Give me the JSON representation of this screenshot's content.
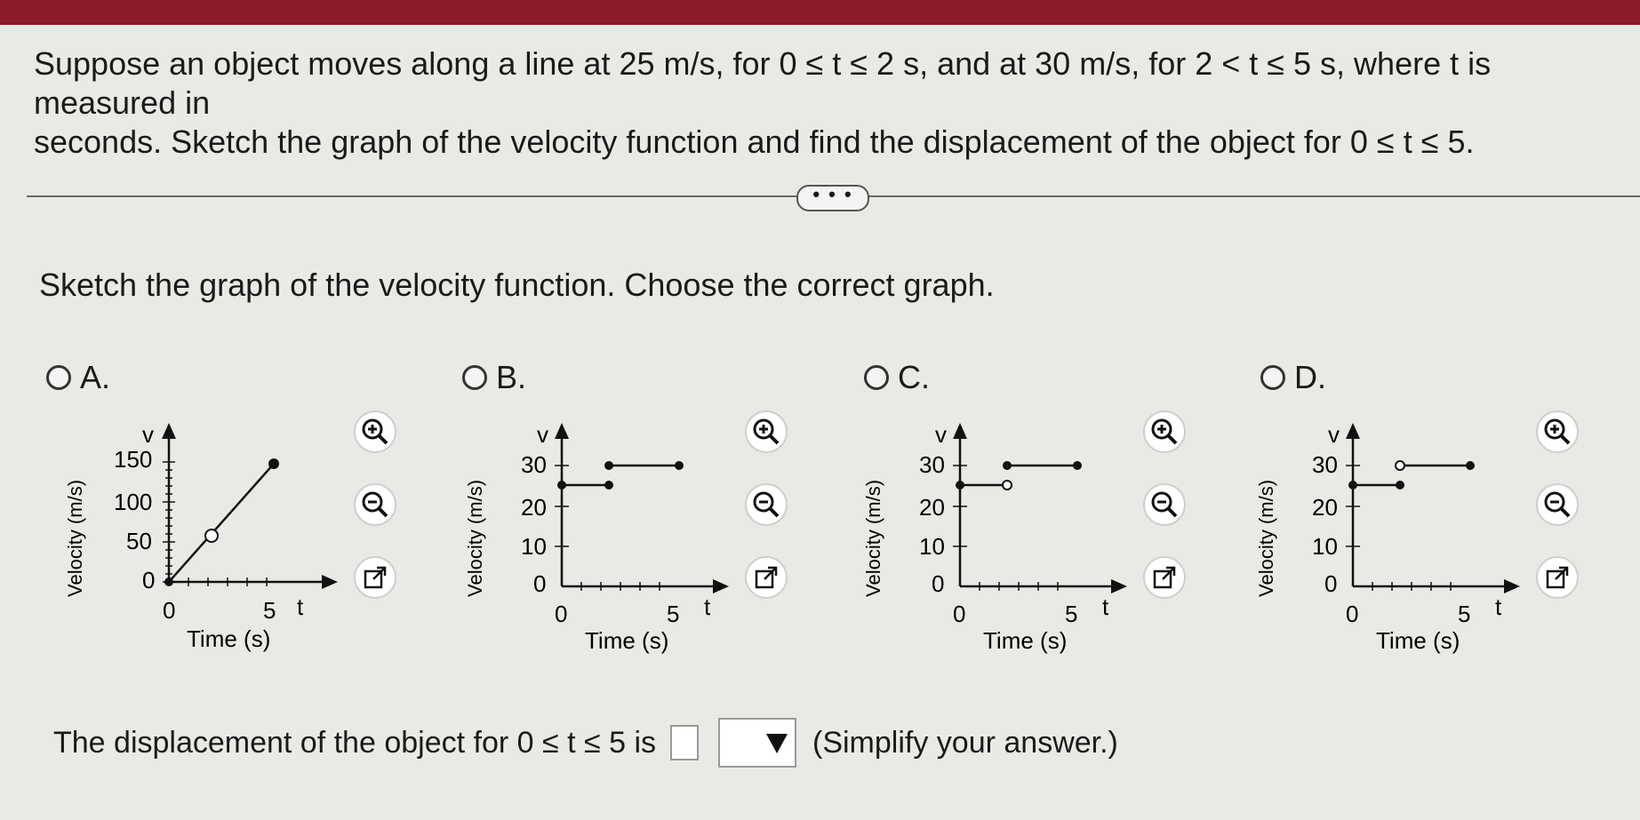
{
  "question": {
    "line1": "Suppose an object moves along a line at 25 m/s, for 0 ≤ t ≤ 2 s, and at 30 m/s, for 2 < t ≤ 5 s, where t is measured in",
    "line2": "seconds. Sketch the graph of the velocity function and find the displacement of the object for 0 ≤ t ≤ 5."
  },
  "more_button": "• • •",
  "prompt": "Sketch the graph of the velocity function. Choose the correct graph.",
  "options": [
    {
      "letter": "A.",
      "ylabel": "Velocity (m/s)",
      "xlabel": "Time (s)",
      "vlabel": "v",
      "tlabel": "t",
      "yticks": [
        "150",
        "100",
        "50",
        "0"
      ],
      "xticks": [
        "0",
        "5"
      ]
    },
    {
      "letter": "B.",
      "ylabel": "Velocity (m/s)",
      "xlabel": "Time (s)",
      "vlabel": "v",
      "tlabel": "t",
      "yticks": [
        "30",
        "20",
        "10",
        "0"
      ],
      "xticks": [
        "0",
        "5"
      ]
    },
    {
      "letter": "C.",
      "ylabel": "Velocity (m/s)",
      "xlabel": "Time (s)",
      "vlabel": "v",
      "tlabel": "t",
      "yticks": [
        "30",
        "20",
        "10",
        "0"
      ],
      "xticks": [
        "0",
        "5"
      ]
    },
    {
      "letter": "D.",
      "ylabel": "Velocity (m/s)",
      "xlabel": "Time (s)",
      "vlabel": "v",
      "tlabel": "t",
      "yticks": [
        "30",
        "20",
        "10",
        "0"
      ],
      "xticks": [
        "0",
        "5"
      ]
    }
  ],
  "tool_icons": [
    "zoom-in-icon",
    "zoom-out-icon",
    "open-external-icon"
  ],
  "answer": {
    "prefix": "The displacement of the object for 0 ≤ t ≤ 5 is",
    "hint": "(Simplify your answer.)"
  },
  "colors": {
    "header": "#8e1b2a",
    "background": "#e9e9e6"
  }
}
